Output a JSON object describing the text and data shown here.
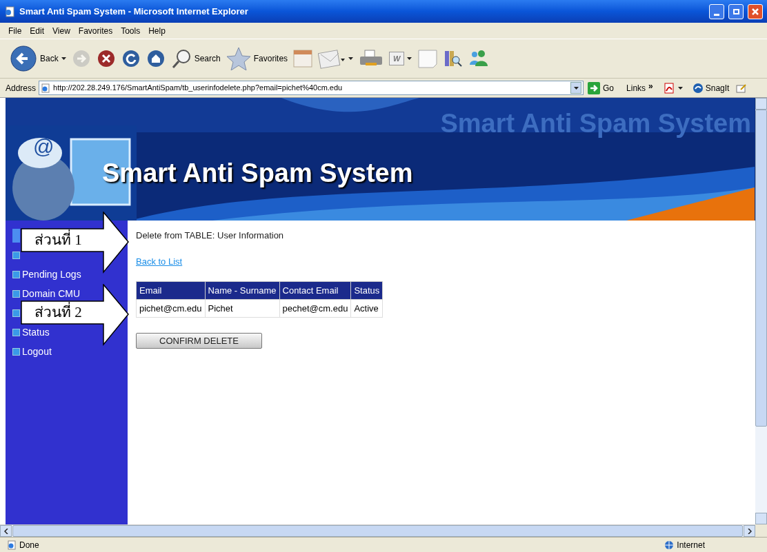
{
  "window": {
    "title": "Smart Anti Spam System - Microsoft Internet Explorer"
  },
  "menu": [
    "File",
    "Edit",
    "View",
    "Favorites",
    "Tools",
    "Help"
  ],
  "toolbar": [
    {
      "kind": "back",
      "label": "Back",
      "disabled": false
    },
    {
      "kind": "forward",
      "disabled": true
    },
    {
      "kind": "stop",
      "disabled": false
    },
    {
      "kind": "refresh",
      "disabled": false
    },
    {
      "kind": "home",
      "disabled": false
    },
    {
      "kind": "search",
      "label": "Search",
      "disabled": false
    },
    {
      "kind": "favorites",
      "label": "Favorites",
      "disabled": false
    },
    {
      "kind": "media",
      "disabled": false
    },
    {
      "kind": "mail",
      "disabled": false
    },
    {
      "kind": "print",
      "disabled": false
    },
    {
      "kind": "word",
      "label": "W",
      "disabled": false
    },
    {
      "kind": "note",
      "disabled": false
    },
    {
      "kind": "research",
      "disabled": false
    },
    {
      "kind": "messenger",
      "disabled": false
    }
  ],
  "address": {
    "label": "Address",
    "value": "http://202.28.249.176/SmartAntiSpam/tb_userinfodelete.php?email=pichet%40cm.edu",
    "go": "Go"
  },
  "links": {
    "label": "Links",
    "more": "»",
    "snagit": "SnagIt"
  },
  "page": {
    "banner": {
      "title": "Smart Anti Spam System",
      "backdrop_text": "Smart Anti Spam System",
      "at_sign": "@"
    },
    "sidebar": [
      {
        "selected": true
      },
      {
        "selected": false
      },
      {
        "label": "Pending Logs",
        "selected": false
      },
      {
        "label": "Domain CMU",
        "selected": false
      },
      {
        "selected": false
      },
      {
        "label": "Status",
        "selected": false
      },
      {
        "label": "Logout",
        "selected": false
      }
    ],
    "heading": "Delete from TABLE: User Information",
    "back_link": "Back to List",
    "table": {
      "columns": [
        "Email",
        "Name - Surname",
        "Contact Email",
        "Status"
      ],
      "rows": [
        [
          "pichet@cm.edu",
          "Pichet",
          "pechet@cm.edu",
          "Active"
        ]
      ]
    },
    "confirm_button": "CONFIRM DELETE"
  },
  "annotations": [
    {
      "label": "ส่วนที่ 1"
    },
    {
      "label": "ส่วนที่ 2"
    }
  ],
  "status_bar": {
    "left": "Done",
    "right": "Internet"
  }
}
